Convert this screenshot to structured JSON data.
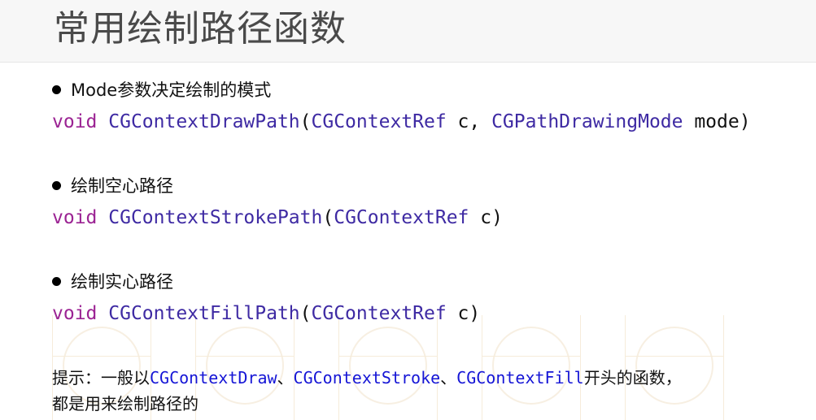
{
  "slide": {
    "title": "常用绘制路径函数"
  },
  "sections": [
    {
      "bullet": "Mode参数决定绘制的模式",
      "code": {
        "keyword": "void",
        "function": "CGContextDrawPath",
        "open": "(",
        "param1_type": "CGContextRef",
        "param1_name": " c, ",
        "param2_type": "CGPathDrawingMode",
        "param2_name": " mode",
        "close": ")"
      }
    },
    {
      "bullet": "绘制空心路径",
      "code": {
        "keyword": "void",
        "function": "CGContextStrokePath",
        "open": "(",
        "param1_type": "CGContextRef",
        "param1_name": " c",
        "close": ")"
      }
    },
    {
      "bullet": "绘制实心路径",
      "code": {
        "keyword": "void",
        "function": "CGContextFillPath",
        "open": "(",
        "param1_type": "CGContextRef",
        "param1_name": " c",
        "close": ")"
      }
    }
  ],
  "tip": {
    "prefix": "提示：一般以",
    "term1": "CGContextDraw",
    "sep1": "、",
    "term2": "CGContextStroke",
    "sep2": "、",
    "term3": "CGContextFill",
    "suffix": "开头的函数，",
    "line2": "都是用来绘制路径的"
  },
  "colors": {
    "keyword": "#9b2393",
    "function": "#3e2aa3",
    "tip_highlight": "#1515d6"
  }
}
